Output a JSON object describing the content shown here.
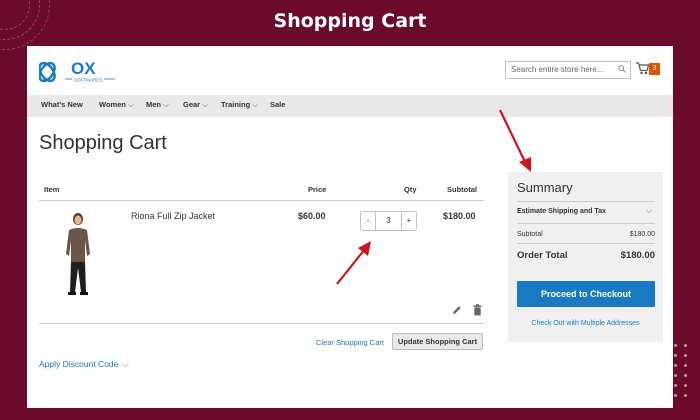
{
  "banner": {
    "title": "Shopping Cart"
  },
  "header": {
    "logo_text": "OX",
    "logo_sub": "SOFTWARES",
    "search_placeholder": "Search entire store here...",
    "cart_count": "3"
  },
  "nav": {
    "items": [
      {
        "label": "What's New",
        "has_chevron": false
      },
      {
        "label": "Women",
        "has_chevron": true
      },
      {
        "label": "Men",
        "has_chevron": true
      },
      {
        "label": "Gear",
        "has_chevron": true
      },
      {
        "label": "Training",
        "has_chevron": true
      },
      {
        "label": "Sale",
        "has_chevron": false
      }
    ]
  },
  "page_title": "Shopping Cart",
  "table": {
    "headers": {
      "item": "Item",
      "price": "Price",
      "qty": "Qty",
      "subtotal": "Subtotal"
    },
    "rows": [
      {
        "name": "Riona Full Zip Jacket",
        "price": "$60.00",
        "qty": "3",
        "subtotal": "$180.00"
      }
    ]
  },
  "actions": {
    "clear_cart": "Clear Shopping Cart",
    "update_cart": "Update Shopping Cart",
    "apply_discount": "Apply Discount Code"
  },
  "summary": {
    "title": "Summary",
    "estimate": "Estimate Shipping and Tax",
    "subtotal_label": "Subtotal",
    "subtotal_value": "$180.00",
    "order_total_label": "Order Total",
    "order_total_value": "$180.00",
    "checkout_button": "Proceed to Checkout",
    "multi_address_link": "Check Out with Multiple Addresses"
  },
  "colors": {
    "background": "#6b0a2a",
    "accent_blue": "#1979c3",
    "badge_orange": "#e05400",
    "arrow_red": "#d0141c"
  },
  "qty_controls": {
    "minus": "-",
    "plus": "+"
  }
}
